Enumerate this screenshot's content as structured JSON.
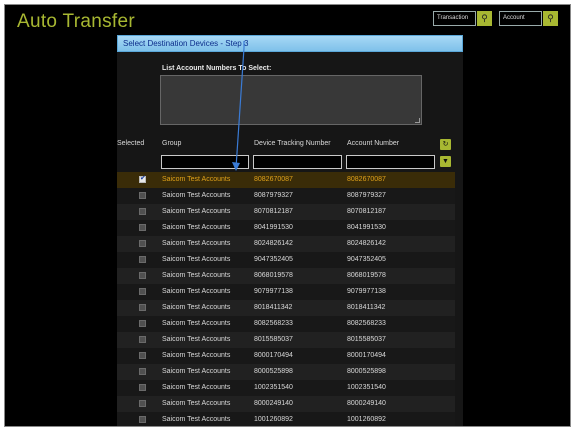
{
  "app": {
    "title": "Auto Transfer"
  },
  "top_search": [
    {
      "placeholder": "Transaction",
      "button_icon": "search-icon"
    },
    {
      "placeholder": "Account",
      "button_icon": "search-icon"
    }
  ],
  "panel": {
    "header": "Select Destination Devices - Step 3",
    "list_label": "List Account Numbers To Select:",
    "list_value": ""
  },
  "table": {
    "columns": [
      "Selected",
      "Group",
      "Device Tracking Number",
      "Account Number"
    ],
    "filters": {
      "group": "",
      "device": "",
      "account": ""
    },
    "rows": [
      {
        "selected": true,
        "group": "Saicom Test Accounts",
        "device": "8082670087",
        "account": "8082670087"
      },
      {
        "selected": false,
        "group": "Saicom Test Accounts",
        "device": "8087979327",
        "account": "8087979327"
      },
      {
        "selected": false,
        "group": "Saicom Test Accounts",
        "device": "8070812187",
        "account": "8070812187"
      },
      {
        "selected": false,
        "group": "Saicom Test Accounts",
        "device": "8041991530",
        "account": "8041991530"
      },
      {
        "selected": false,
        "group": "Saicom Test Accounts",
        "device": "8024826142",
        "account": "8024826142"
      },
      {
        "selected": false,
        "group": "Saicom Test Accounts",
        "device": "9047352405",
        "account": "9047352405"
      },
      {
        "selected": false,
        "group": "Saicom Test Accounts",
        "device": "8068019578",
        "account": "8068019578"
      },
      {
        "selected": false,
        "group": "Saicom Test Accounts",
        "device": "9079977138",
        "account": "9079977138"
      },
      {
        "selected": false,
        "group": "Saicom Test Accounts",
        "device": "8018411342",
        "account": "8018411342"
      },
      {
        "selected": false,
        "group": "Saicom Test Accounts",
        "device": "8082568233",
        "account": "8082568233"
      },
      {
        "selected": false,
        "group": "Saicom Test Accounts",
        "device": "8015585037",
        "account": "8015585037"
      },
      {
        "selected": false,
        "group": "Saicom Test Accounts",
        "device": "8000170494",
        "account": "8000170494"
      },
      {
        "selected": false,
        "group": "Saicom Test Accounts",
        "device": "8000525898",
        "account": "8000525898"
      },
      {
        "selected": false,
        "group": "Saicom Test Accounts",
        "device": "1002351540",
        "account": "1002351540"
      },
      {
        "selected": false,
        "group": "Saicom Test Accounts",
        "device": "8000249140",
        "account": "8000249140"
      },
      {
        "selected": false,
        "group": "Saicom Test Accounts",
        "device": "1001260892",
        "account": "1001260892"
      }
    ]
  },
  "icons": {
    "refresh": "refresh-icon",
    "filter": "filter-icon"
  },
  "colors": {
    "accent": "#a8b832",
    "header_bg": "#8fcaf0",
    "selected_text": "#e0a21a",
    "annotation": "#3a7bd5"
  }
}
